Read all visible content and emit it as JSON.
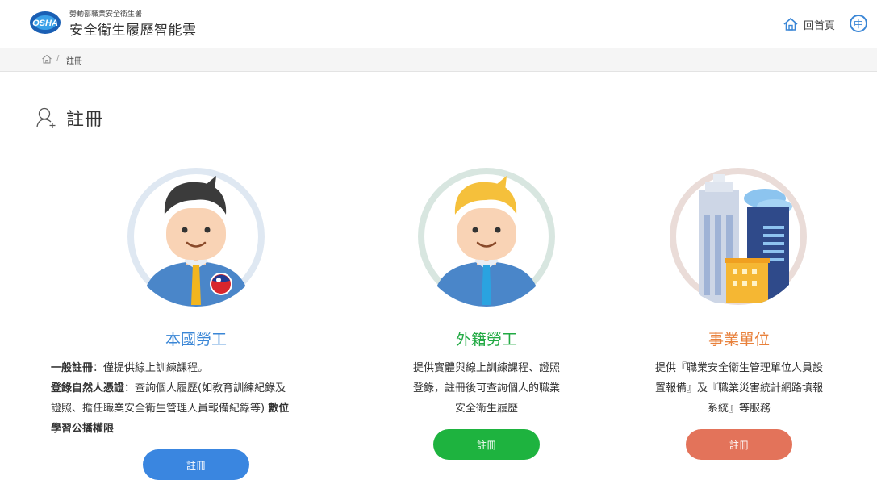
{
  "header": {
    "logo_text": "OSHA",
    "org_name": "勞動部職業安全衛生署",
    "app_title": "安全衛生履歷智能雲",
    "home_label": "回首頁",
    "lang_label": "中"
  },
  "breadcrumb": {
    "separator": "/",
    "current": "註冊"
  },
  "page": {
    "title": "註冊"
  },
  "cards": [
    {
      "title": "本國勞工",
      "title_color": "#3a86d6",
      "desc_line1_bold": "一般註冊",
      "desc_line1_rest": "：僅提供線上訓練課程。",
      "desc_line2_bold": "登錄自然人憑證",
      "desc_line2_rest": "：查詢個人履歷(如教育訓練紀錄及",
      "desc_line3": "證照、擔任職業安全衛生管理人員報備紀錄等)",
      "desc_line3_bold": "數位",
      "desc_line4_bold": "學習公播權限",
      "button": "註冊",
      "button_color": "#3a86e0"
    },
    {
      "title": "外籍勞工",
      "title_color": "#22aa44",
      "desc_lines": [
        "提供實體與線上訓練課程、證照",
        "登錄，註冊後可查詢個人的職業",
        "安全衛生履歷"
      ],
      "button": "註冊",
      "button_color": "#1eb33f"
    },
    {
      "title": "事業單位",
      "title_color": "#e8813c",
      "desc_lines": [
        "提供『職業安全衛生管理單位人員設",
        "置報備』及『職業災害統計網路填報",
        "系統』等服務"
      ],
      "button": "註冊",
      "button_color": "#e3735a"
    }
  ]
}
